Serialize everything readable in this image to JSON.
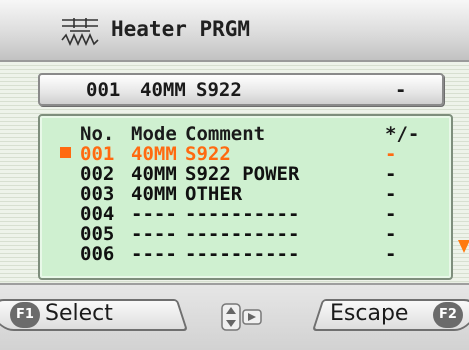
{
  "header": {
    "title": "Heater PRGM",
    "icon": "heater-icon"
  },
  "selected_program": {
    "number": "001",
    "mode": "40MM",
    "comment": "S922",
    "pm": "-"
  },
  "list": {
    "columns": {
      "no": "No.",
      "mode": "Mode",
      "comment": "Comment",
      "pm": "*/-"
    },
    "rows": [
      {
        "no": "001",
        "mode": "40MM",
        "comment": "S922",
        "pm": "-",
        "selected": true
      },
      {
        "no": "002",
        "mode": "40MM",
        "comment": "S922 POWER",
        "pm": "-"
      },
      {
        "no": "003",
        "mode": "40MM",
        "comment": "OTHER",
        "pm": "-"
      },
      {
        "no": "004",
        "mode": "----",
        "comment": "----------",
        "pm": "-"
      },
      {
        "no": "005",
        "mode": "----",
        "comment": "----------",
        "pm": "-"
      },
      {
        "no": "006",
        "mode": "----",
        "comment": "----------",
        "pm": "-"
      }
    ]
  },
  "softkeys": {
    "f1_key": "F1",
    "f1_label": "Select",
    "f2_key": "F2",
    "f2_label": "Escape",
    "nav_icon": "nav-updown-right-icon"
  },
  "colors": {
    "highlight": "#ff6a10",
    "panel": "#cff0d0",
    "scroll_arrow": "#ff7a10"
  }
}
